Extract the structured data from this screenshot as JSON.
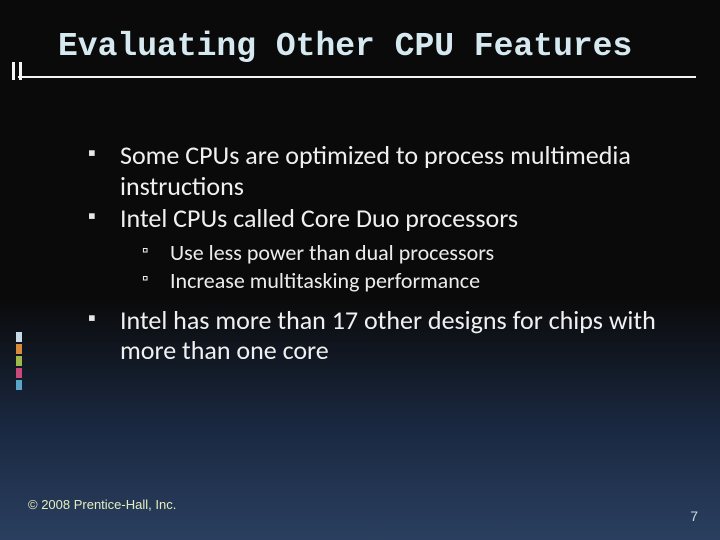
{
  "title": "Evaluating Other CPU Features",
  "bullets": [
    {
      "text": "Some CPUs are optimized to process multimedia instructions"
    },
    {
      "text": "Intel CPUs called Core Duo processors",
      "sub": [
        "Use less power than dual processors",
        "Increase multitasking performance"
      ]
    },
    {
      "text": "Intel has more than 17 other designs for chips with more than one core"
    }
  ],
  "footer": "© 2008 Prentice-Hall, Inc.",
  "page_number": "7"
}
